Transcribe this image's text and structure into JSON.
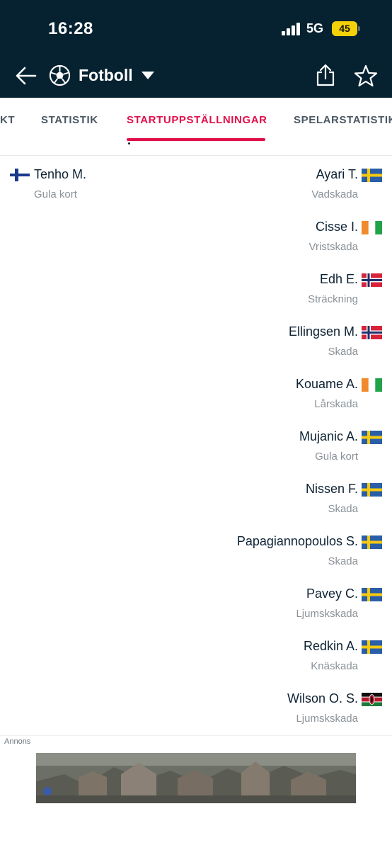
{
  "status_bar": {
    "time": "16:28",
    "network": "5G",
    "battery": "45"
  },
  "nav": {
    "title": "Fotboll"
  },
  "tabs": [
    {
      "label": "KT",
      "active": false
    },
    {
      "label": "STATISTIK",
      "active": false
    },
    {
      "label": "STARTUPPSTÄLLNINGAR",
      "active": true
    },
    {
      "label": "SPELARSTATISTIK",
      "active": false
    }
  ],
  "left_team": [
    {
      "name": "Tenho M.",
      "reason": "Gula kort",
      "flag": "finland"
    }
  ],
  "right_team": [
    {
      "name": "Ayari T.",
      "reason": "Vadskada",
      "flag": "sweden"
    },
    {
      "name": "Cisse I.",
      "reason": "Vristskada",
      "flag": "ivory-coast"
    },
    {
      "name": "Edh E.",
      "reason": "Sträckning",
      "flag": "norway"
    },
    {
      "name": "Ellingsen M.",
      "reason": "Skada",
      "flag": "norway"
    },
    {
      "name": "Kouame A.",
      "reason": "Lårskada",
      "flag": "ivory-coast"
    },
    {
      "name": "Mujanic A.",
      "reason": "Gula kort",
      "flag": "sweden"
    },
    {
      "name": "Nissen F.",
      "reason": "Skada",
      "flag": "sweden"
    },
    {
      "name": "Papagiannopoulos S.",
      "reason": "Skada",
      "flag": "sweden"
    },
    {
      "name": "Pavey C.",
      "reason": "Ljumskskada",
      "flag": "sweden"
    },
    {
      "name": "Redkin A.",
      "reason": "Knäskada",
      "flag": "sweden"
    },
    {
      "name": "Wilson O. S.",
      "reason": "Ljumskskada",
      "flag": "kenya"
    }
  ],
  "ad": {
    "label": "Annons"
  },
  "colors": {
    "header_bg": "#062230",
    "accent": "#e0104a",
    "text": "#0d2233",
    "muted": "#8b9298"
  }
}
